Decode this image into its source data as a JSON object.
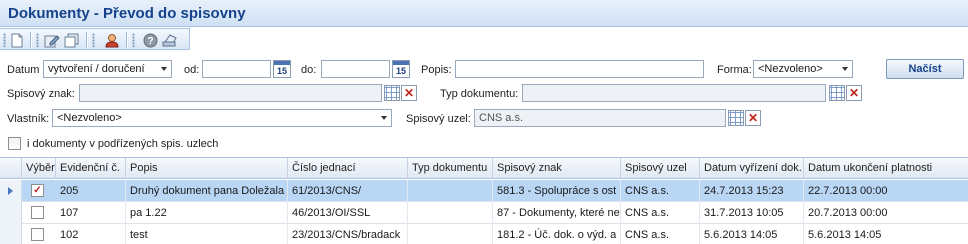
{
  "window": {
    "title": "Dokumenty - Převod do spisovny"
  },
  "toolbar": {
    "icons": [
      "new-document-icon",
      "edit-icon",
      "copy-icon",
      "user-icon",
      "help-icon",
      "print-icon"
    ]
  },
  "filter": {
    "datum_label": "Datum",
    "datum_type": "vytvoření / doručení",
    "od_label": "od:",
    "od_value": "",
    "do_label": "do:",
    "do_value": "",
    "calendar_day": "15",
    "popis_label": "Popis:",
    "popis_value": "",
    "forma_label": "Forma:",
    "forma_value": "<Nezvoleno>",
    "search_button": "Načíst",
    "spisovy_znak_label": "Spisový znak:",
    "spisovy_znak_value": "",
    "typ_dokumentu_label": "Typ dokumentu:",
    "typ_dokumentu_value": "",
    "vlastnik_label": "Vlastník:",
    "vlastnik_value": "<Nezvoleno>",
    "spisovy_uzel_label": "Spisový uzel:",
    "spisovy_uzel_value": "CNS a.s.",
    "subnodes_checkbox_label": "i dokumenty v podřízených spis. uzlech",
    "subnodes_checked": false
  },
  "grid": {
    "columns": [
      "Výběr",
      "Evidenční č.",
      "Popis",
      "Číslo jednací",
      "Typ dokumentu",
      "Spisový znak",
      "Spisový uzel",
      "Datum vyřízení dok.",
      "Datum ukončení platnosti"
    ],
    "rows": [
      {
        "selected": true,
        "checked": true,
        "cells": [
          "205",
          "Druhý dokument pana Doležala",
          "61/2013/CNS/",
          "",
          "581.3 - Spolupráce s ost",
          "CNS a.s.",
          "24.7.2013 15:23",
          "22.7.2013 00:00"
        ]
      },
      {
        "selected": false,
        "checked": false,
        "cells": [
          "107",
          "pa 1.22",
          "46/2013/OI/SSL",
          "",
          "87 - Dokumenty, které ne",
          "CNS a.s.",
          "31.7.2013 10:05",
          "20.7.2013 00:00"
        ]
      },
      {
        "selected": false,
        "checked": false,
        "cells": [
          "102",
          "test",
          "23/2013/CNS/bradack",
          "",
          "181.2 - Úč. dok. o výd. a",
          "CNS a.s.",
          "5.6.2013 14:05",
          "5.6.2013 14:05"
        ]
      }
    ]
  },
  "colors": {
    "title": "#15428b",
    "selection": "#b9d6f5",
    "header_bg": "#dfe8f3"
  }
}
